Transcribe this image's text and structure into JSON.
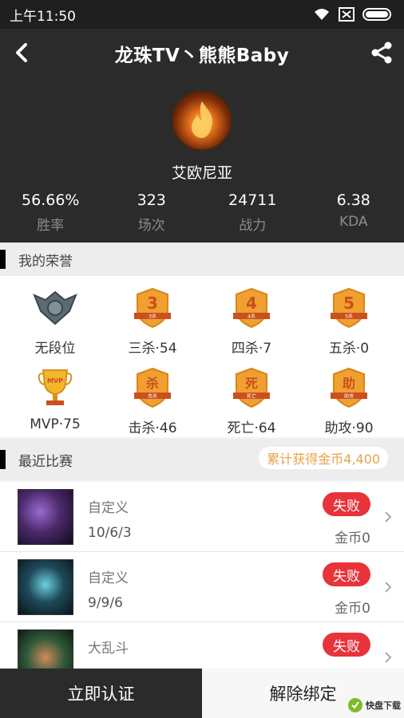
{
  "status_bar": {
    "time": "上午11:50"
  },
  "header": {
    "title": "龙珠TV丶熊熊Baby",
    "hero_name": "艾欧尼亚",
    "stats": [
      {
        "value": "56.66%",
        "label": "胜率"
      },
      {
        "value": "323",
        "label": "场次"
      },
      {
        "value": "24711",
        "label": "战力"
      },
      {
        "value": "6.38",
        "label": "KDA"
      }
    ]
  },
  "honors": {
    "section_title": "我的荣誉",
    "items": [
      {
        "label": "无段位",
        "icon": "rank-emblem-icon"
      },
      {
        "label": "三杀·54",
        "icon": "triple-kill-shield-icon",
        "glyph": "3",
        "sub": "3杀"
      },
      {
        "label": "四杀·7",
        "icon": "quadra-kill-shield-icon",
        "glyph": "4",
        "sub": "4杀"
      },
      {
        "label": "五杀·0",
        "icon": "penta-kill-shield-icon",
        "glyph": "5",
        "sub": "5杀"
      },
      {
        "label": "MVP·75",
        "icon": "mvp-trophy-icon",
        "glyph": "MVP"
      },
      {
        "label": "击杀·46",
        "icon": "kill-shield-icon",
        "glyph": "杀",
        "sub": "击杀"
      },
      {
        "label": "死亡·64",
        "icon": "death-shield-icon",
        "glyph": "死",
        "sub": "死亡"
      },
      {
        "label": "助攻·90",
        "icon": "assist-shield-icon",
        "glyph": "助",
        "sub": "助攻"
      }
    ]
  },
  "recent": {
    "section_title": "最近比赛",
    "coins_total": "累计获得金币4,400",
    "matches": [
      {
        "mode": "自定义",
        "kda": "10/6/3",
        "result": "失败",
        "coins": "金币0",
        "thumb_color": "#4a2a6a"
      },
      {
        "mode": "自定义",
        "kda": "9/9/6",
        "result": "失败",
        "coins": "金币0",
        "thumb_color": "#1f4a5a"
      },
      {
        "mode": "大乱斗",
        "kda": "",
        "result": "失败",
        "coins": "",
        "thumb_color": "#2f5a3a"
      }
    ]
  },
  "bottom": {
    "verify_label": "立即认证",
    "unbind_label": "解除绑定"
  },
  "watermark": {
    "text": "快盘下载"
  },
  "colors": {
    "header_bg": "#2b2b2b",
    "loss_red": "#e8333a",
    "gold": "#e8a24a",
    "shield_orange": "#f0a030"
  }
}
